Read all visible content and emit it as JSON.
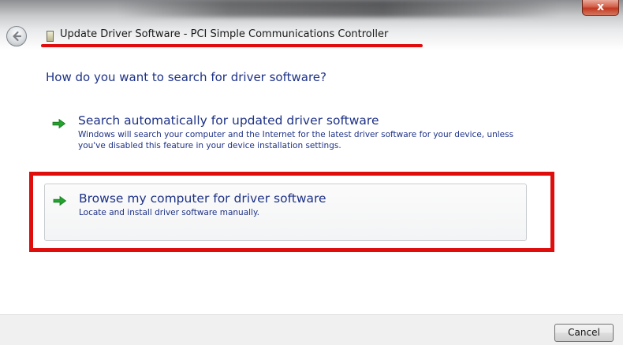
{
  "window": {
    "title": "Update Driver Software - PCI Simple Communications Controller",
    "close_label": "x"
  },
  "icons": {
    "back": "back-arrow-icon",
    "title": "device-icon",
    "option_arrow": "green-arrow-icon",
    "close": "close-icon"
  },
  "colors": {
    "heading_text": "#1e3287",
    "arrow_green": "#25a32e",
    "annotation_red": "#e00d0d",
    "close_button": "#c0391f"
  },
  "main": {
    "heading": "How do you want to search for driver software?",
    "options": [
      {
        "title": "Search automatically for updated driver software",
        "description": "Windows will search your computer and the Internet for the latest driver software for your device, unless you've disabled this feature in your device installation settings."
      },
      {
        "title": "Browse my computer for driver software",
        "description": "Locate and install driver software manually."
      }
    ]
  },
  "footer": {
    "cancel_label": "Cancel"
  }
}
